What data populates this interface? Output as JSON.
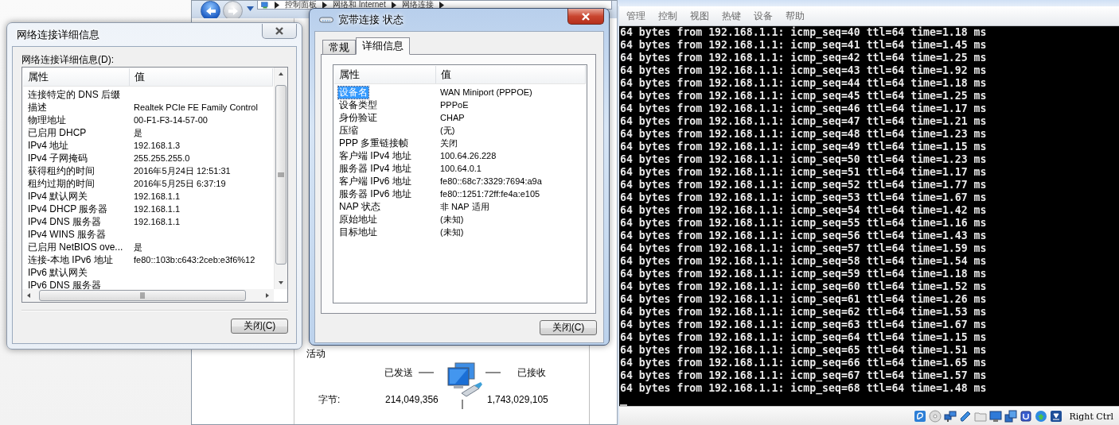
{
  "explorer": {
    "breadcrumb": [
      "控制面板",
      "网络和 Internet",
      "网络连接"
    ],
    "activity": {
      "heading": "活动",
      "sent_label": "已发送",
      "received_label": "已接收",
      "bytes_label": "字节:",
      "sent": "214,049,356",
      "received": "1,743,029,105"
    }
  },
  "details_dialog": {
    "title": "网络连接详细信息",
    "list_label": "网络连接详细信息(D):",
    "columns": [
      "属性",
      "值"
    ],
    "rows": [
      {
        "property": "连接特定的 DNS 后缀"
      },
      {
        "property": "描述",
        "value": "Realtek PCIe FE Family Control"
      },
      {
        "property": "物理地址",
        "value": "00-F1-F3-14-57-00"
      },
      {
        "property": "已启用 DHCP",
        "value": "是"
      },
      {
        "property": "IPv4 地址",
        "value": "192.168.1.3"
      },
      {
        "property": "IPv4 子网掩码",
        "value": "255.255.255.0"
      },
      {
        "property": "获得租约的时间",
        "value": "2016年5月24日 12:51:31"
      },
      {
        "property": "租约过期的时间",
        "value": "2016年5月25日 6:37:19"
      },
      {
        "property": "IPv4 默认网关",
        "value": "192.168.1.1"
      },
      {
        "property": "IPv4 DHCP 服务器",
        "value": "192.168.1.1"
      },
      {
        "property": "IPv4 DNS 服务器",
        "value": "192.168.1.1"
      },
      {
        "property": "IPv4 WINS 服务器"
      },
      {
        "property": "已启用 NetBIOS ove...",
        "value": "是"
      },
      {
        "property": "连接-本地 IPv6 地址",
        "value": "fe80::103b:c643:2ceb:e3f6%12"
      },
      {
        "property": "IPv6 默认网关"
      },
      {
        "property": "IPv6 DNS 服务器"
      }
    ],
    "close_button": "关闭(C)"
  },
  "status_dialog": {
    "title": "宽带连接 状态",
    "tabs": [
      {
        "label": "常规",
        "selected": false
      },
      {
        "label": "详细信息",
        "selected": true
      }
    ],
    "columns": [
      "属性",
      "值"
    ],
    "rows": [
      {
        "property": "设备名",
        "value": "WAN Miniport (PPPOE)",
        "selected": true
      },
      {
        "property": "设备类型",
        "value": "PPPoE",
        "selected": false
      },
      {
        "property": "身份验证",
        "value": "CHAP",
        "selected": false
      },
      {
        "property": "压缩",
        "value": "(无)",
        "selected": false
      },
      {
        "property": "PPP 多重链接帧",
        "value": "关闭",
        "selected": false
      },
      {
        "property": "客户端 IPv4 地址",
        "value": "100.64.26.228",
        "selected": false
      },
      {
        "property": "服务器 IPv4 地址",
        "value": "100.64.0.1",
        "selected": false
      },
      {
        "property": "客户端 IPv6 地址",
        "value": "fe80::68c7:3329:7694:a9a",
        "selected": false
      },
      {
        "property": "服务器 IPv6 地址",
        "value": "fe80::1251:72ff:fe4a:e105",
        "selected": false
      },
      {
        "property": "NAP 状态",
        "value": "非 NAP 适用",
        "selected": false
      },
      {
        "property": "原始地址",
        "value": "(未知)",
        "selected": false
      },
      {
        "property": "目标地址",
        "value": "(未知)",
        "selected": false
      }
    ],
    "close_button": "关闭(C)"
  },
  "terminal": {
    "menu": [
      "管理",
      "控制",
      "视图",
      "热键",
      "设备",
      "帮助"
    ],
    "lines": [
      "64 bytes from 192.168.1.1: icmp_seq=40 ttl=64 time=1.18 ms",
      "64 bytes from 192.168.1.1: icmp_seq=41 ttl=64 time=1.45 ms",
      "64 bytes from 192.168.1.1: icmp_seq=42 ttl=64 time=1.25 ms",
      "64 bytes from 192.168.1.1: icmp_seq=43 ttl=64 time=1.92 ms",
      "64 bytes from 192.168.1.1: icmp_seq=44 ttl=64 time=1.18 ms",
      "64 bytes from 192.168.1.1: icmp_seq=45 ttl=64 time=1.25 ms",
      "64 bytes from 192.168.1.1: icmp_seq=46 ttl=64 time=1.17 ms",
      "64 bytes from 192.168.1.1: icmp_seq=47 ttl=64 time=1.21 ms",
      "64 bytes from 192.168.1.1: icmp_seq=48 ttl=64 time=1.23 ms",
      "64 bytes from 192.168.1.1: icmp_seq=49 ttl=64 time=1.15 ms",
      "64 bytes from 192.168.1.1: icmp_seq=50 ttl=64 time=1.23 ms",
      "64 bytes from 192.168.1.1: icmp_seq=51 ttl=64 time=1.17 ms",
      "64 bytes from 192.168.1.1: icmp_seq=52 ttl=64 time=1.77 ms",
      "64 bytes from 192.168.1.1: icmp_seq=53 ttl=64 time=1.67 ms",
      "64 bytes from 192.168.1.1: icmp_seq=54 ttl=64 time=1.42 ms",
      "64 bytes from 192.168.1.1: icmp_seq=55 ttl=64 time=1.16 ms",
      "64 bytes from 192.168.1.1: icmp_seq=56 ttl=64 time=1.43 ms",
      "64 bytes from 192.168.1.1: icmp_seq=57 ttl=64 time=1.59 ms",
      "64 bytes from 192.168.1.1: icmp_seq=58 ttl=64 time=1.54 ms",
      "64 bytes from 192.168.1.1: icmp_seq=59 ttl=64 time=1.18 ms",
      "64 bytes from 192.168.1.1: icmp_seq=60 ttl=64 time=1.52 ms",
      "64 bytes from 192.168.1.1: icmp_seq=61 ttl=64 time=1.26 ms",
      "64 bytes from 192.168.1.1: icmp_seq=62 ttl=64 time=1.53 ms",
      "64 bytes from 192.168.1.1: icmp_seq=63 ttl=64 time=1.67 ms",
      "64 bytes from 192.168.1.1: icmp_seq=64 ttl=64 time=1.15 ms",
      "64 bytes from 192.168.1.1: icmp_seq=65 ttl=64 time=1.51 ms",
      "64 bytes from 192.168.1.1: icmp_seq=66 ttl=64 time=1.65 ms",
      "64 bytes from 192.168.1.1: icmp_seq=67 ttl=64 time=1.57 ms",
      "64 bytes from 192.168.1.1: icmp_seq=68 ttl=64 time=1.48 ms"
    ],
    "host_key": "Right Ctrl"
  }
}
